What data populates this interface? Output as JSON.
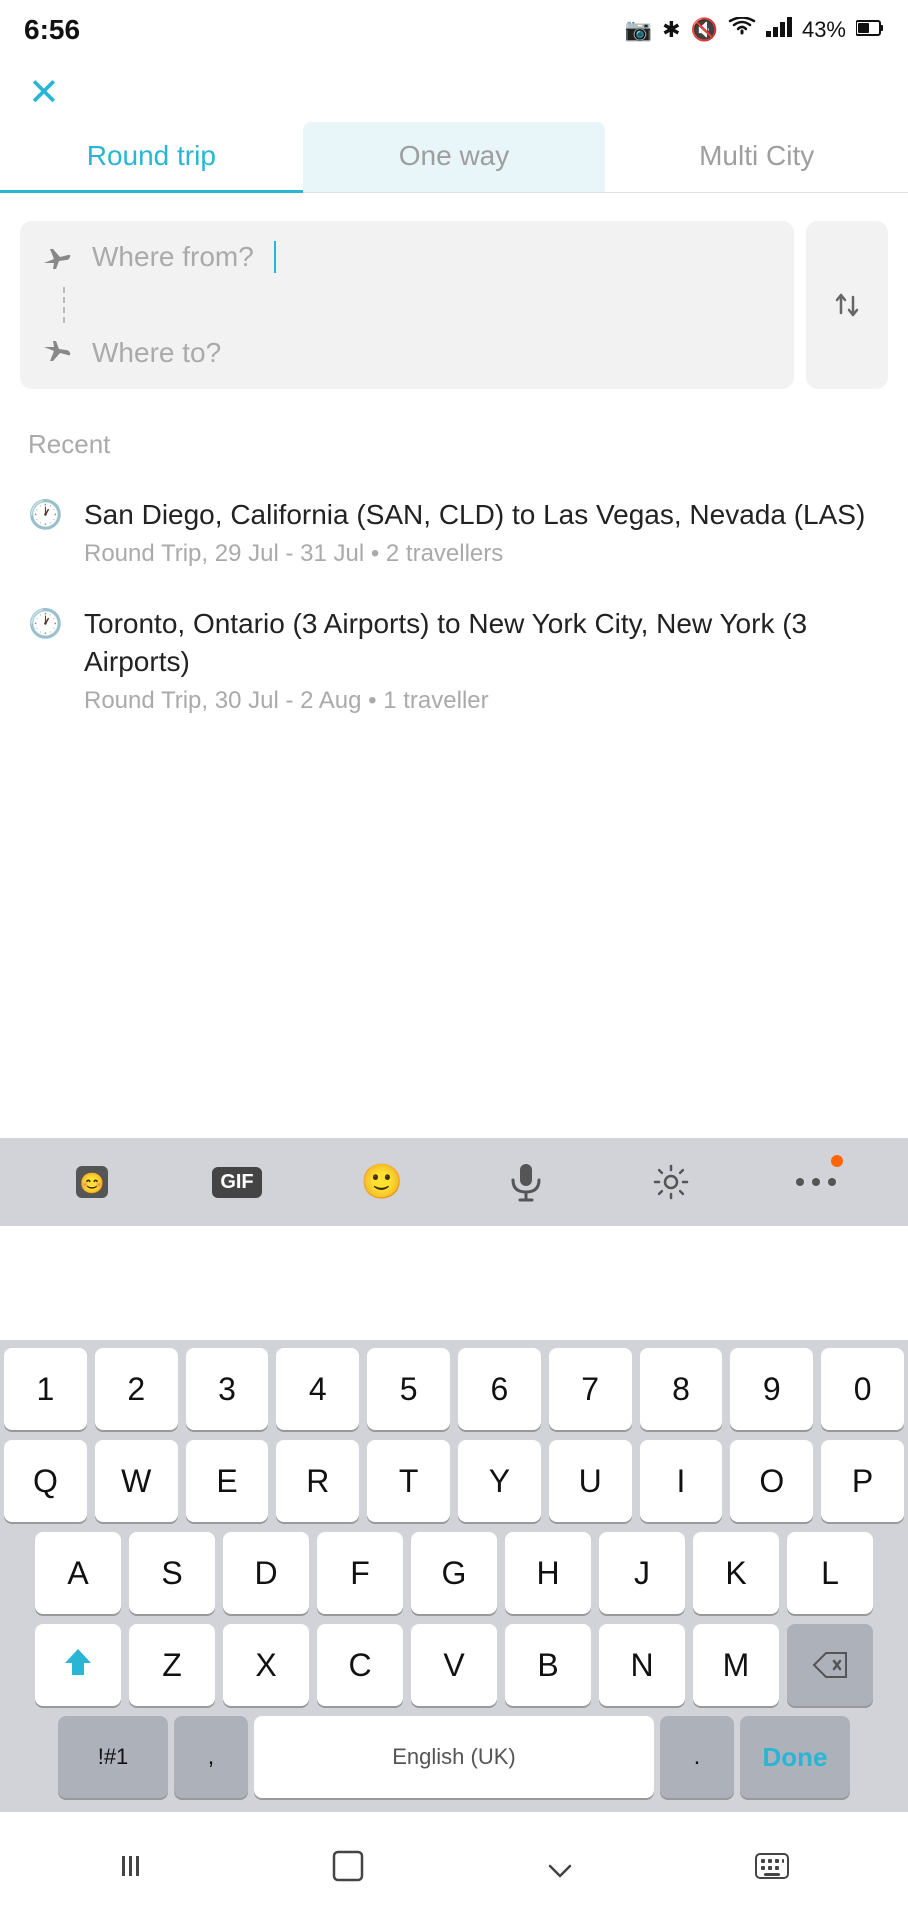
{
  "statusBar": {
    "time": "6:56",
    "batteryPercent": "43%"
  },
  "tabs": [
    {
      "id": "round-trip",
      "label": "Round trip",
      "active": true,
      "selectedBg": false
    },
    {
      "id": "one-way",
      "label": "One way",
      "active": false,
      "selectedBg": true
    },
    {
      "id": "multi-city",
      "label": "Multi City",
      "active": false,
      "selectedBg": false
    }
  ],
  "searchFields": {
    "fromPlaceholder": "Where from?",
    "toPlaceholder": "Where to?"
  },
  "recent": {
    "label": "Recent",
    "items": [
      {
        "main": "San Diego, California (SAN, CLD) to Las Vegas, Nevada (LAS)",
        "sub": "Round Trip, 29 Jul - 31 Jul • 2 travellers"
      },
      {
        "main": "Toronto, Ontario (3 Airports) to New York City, New York (3 Airports)",
        "sub": "Round Trip, 30 Jul - 2 Aug • 1 traveller"
      }
    ]
  },
  "keyboard": {
    "toolbar": {
      "emoji_sticker": "🎭",
      "gif": "GIF",
      "emoji": "😊",
      "mic": "🎤",
      "settings": "⚙️",
      "more": "···"
    },
    "rows": [
      [
        "1",
        "2",
        "3",
        "4",
        "5",
        "6",
        "7",
        "8",
        "9",
        "0"
      ],
      [
        "Q",
        "W",
        "E",
        "R",
        "T",
        "Y",
        "U",
        "I",
        "O",
        "P"
      ],
      [
        "A",
        "S",
        "D",
        "F",
        "G",
        "H",
        "J",
        "K",
        "L"
      ],
      [
        "Z",
        "X",
        "C",
        "V",
        "B",
        "N",
        "M"
      ],
      [
        "!#1",
        ",",
        "English (UK)",
        ".",
        "Done"
      ]
    ]
  },
  "navBar": {
    "back": "|||",
    "home": "□",
    "down": "∨",
    "keyboard": "⊞"
  }
}
